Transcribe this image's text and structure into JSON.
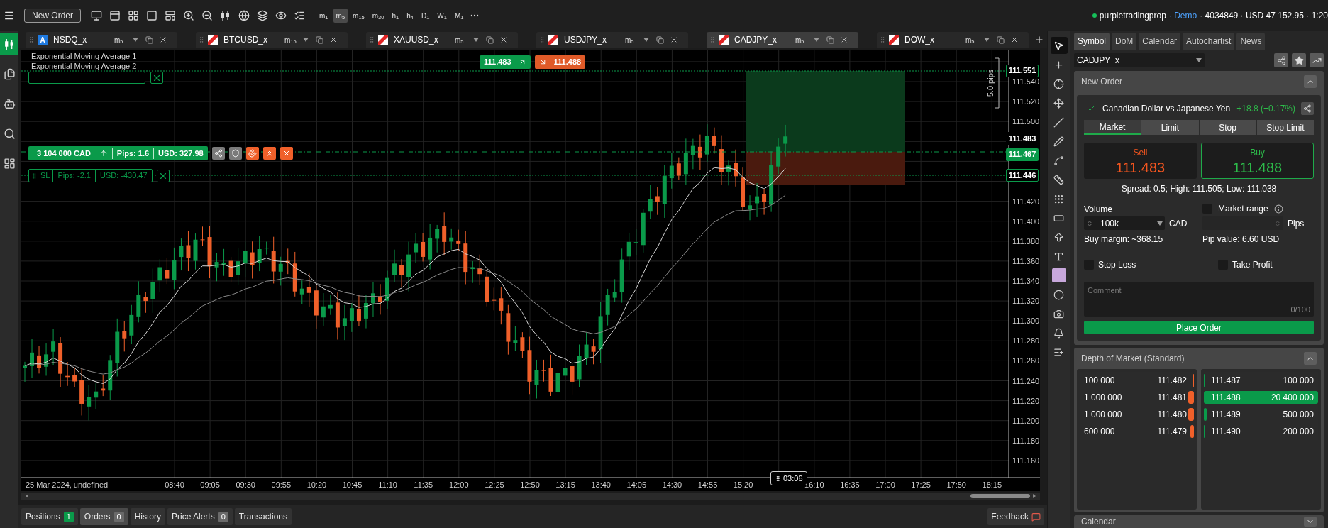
{
  "top_bar": {
    "new_order_button": "New Order",
    "timeframes": [
      {
        "label": "m$_{1}$",
        "selected": false
      },
      {
        "label": "m$_{5}$",
        "selected": true
      },
      {
        "label": "m$_{15}$",
        "selected": false
      },
      {
        "label": "m$_{30}$",
        "selected": false
      },
      {
        "label": "h$_{1}$",
        "selected": false
      },
      {
        "label": "h$_{4}$",
        "selected": false
      },
      {
        "label": "D$_{1}$",
        "selected": false
      },
      {
        "label": "W$_{1}$",
        "selected": false
      },
      {
        "label": "M$_{1}$",
        "selected": false
      }
    ],
    "account": {
      "name": "purpletradingprop",
      "mode": "· Demo",
      "details": "· 4034849 · USD 47 152.95 · 1:20"
    }
  },
  "left_sidebar": [
    {
      "selected": true
    },
    {
      "selected": false
    },
    {
      "selected": false
    },
    {
      "selected": false
    },
    {
      "selected": false
    }
  ],
  "chart_tabs": [
    {
      "kind": "letter",
      "badge": "A",
      "symbol": "NSDQ_x",
      "timeframe": "m$_{5}$",
      "selected": false
    },
    {
      "kind": "flag",
      "symbol": "BTCUSD_x",
      "timeframe": "m$_{15}$",
      "selected": false
    },
    {
      "kind": "flag",
      "symbol": "XAUUSD_x",
      "timeframe": "m$_{5}$",
      "selected": false
    },
    {
      "kind": "flag",
      "symbol": "USDJPY_x",
      "timeframe": "m$_{5}$",
      "selected": false
    },
    {
      "kind": "flag",
      "symbol": "CADJPY_x",
      "timeframe": "m$_{5}$",
      "selected": true
    },
    {
      "kind": "flag",
      "symbol": "DOW_x",
      "timeframe": "m$_{5}$",
      "selected": false
    }
  ],
  "chart": {
    "legend": [
      "Exponential Moving Average 1",
      "Exponential Moving Average 2"
    ],
    "quotes": [
      {
        "kind": "bid",
        "price": "111.483"
      },
      {
        "kind": "ask",
        "price": "111.488"
      }
    ],
    "position_line": {
      "volume": "3 104 000 CAD",
      "pips": "Pips: 1.6",
      "pnl": "USD: 327.98"
    },
    "stop_loss_line": {
      "label": "SL",
      "pips": "Pips: -2.1",
      "pnl": "USD: -430.47"
    },
    "price_ticks": [
      "111.540",
      "111.520",
      "111.500",
      "111.420",
      "111.400",
      "111.380",
      "111.360",
      "111.340",
      "111.320",
      "111.300",
      "111.280",
      "111.260",
      "111.240",
      "111.220",
      "111.200",
      "111.180",
      "111.160"
    ],
    "price_tags": [
      {
        "kind": "tp",
        "price": "111.551"
      },
      {
        "kind": "last",
        "price": "111.483"
      },
      {
        "kind": "position",
        "price": "111.467"
      },
      {
        "kind": "sl",
        "price": "111.446"
      }
    ],
    "range_label": "5.0 pips",
    "date_label": "25 Mar 2024, undefined",
    "time_ticks": [
      "08:40",
      "09:05",
      "09:30",
      "09:55",
      "10:20",
      "10:45",
      "11:10",
      "11:35",
      "12:00",
      "12:25",
      "12:50",
      "13:15",
      "13:40",
      "14:05",
      "14:30",
      "14:55",
      "15:20",
      "16:10",
      "16:35",
      "17:00",
      "17:25",
      "17:50",
      "18:15"
    ],
    "countdown": "03:06"
  },
  "bottom_tabs": [
    {
      "label": "Positions",
      "count": "1",
      "color": "#0a9a4a",
      "selected": false
    },
    {
      "label": "Orders",
      "count": "0",
      "color": "#6a6a6a",
      "selected": true
    },
    {
      "label": "History",
      "selected": false
    },
    {
      "label": "Price Alerts",
      "count": "0",
      "color": "#6a6a6a",
      "selected": false
    },
    {
      "label": "Transactions",
      "selected": false
    }
  ],
  "feedback": "Feedback",
  "drawing_tools": [
    {
      "selected": true
    },
    {
      "selected": false
    },
    {
      "selected": false
    },
    {
      "selected": false
    },
    {
      "selected": false
    },
    {
      "selected": false
    },
    {
      "selected": false
    },
    {
      "selected": false
    },
    {
      "selected": false
    },
    {
      "selected": false
    },
    {
      "selected": false
    },
    {
      "selected": false
    },
    {
      "selected": false
    },
    {
      "selected": false
    },
    {
      "selected": false
    },
    {
      "selected": false
    },
    {
      "selected": false
    }
  ],
  "side_tabs": [
    {
      "label": "Symbol",
      "selected": true
    },
    {
      "label": "DoM",
      "selected": false
    },
    {
      "label": "Calendar",
      "selected": false
    },
    {
      "label": "Autochartist",
      "selected": false
    },
    {
      "label": "News",
      "selected": false
    }
  ],
  "symbol_select": "CADJPY_x",
  "new_order": {
    "title": "New Order",
    "expanded": true,
    "instrument": "Canadian Dollar vs Japanese Yen",
    "change": "+18.8 (+0.17%)",
    "order_types": [
      {
        "label": "Market",
        "selected": true
      },
      {
        "label": "Limit",
        "selected": false
      },
      {
        "label": "Stop",
        "selected": false
      },
      {
        "label": "Stop Limit",
        "selected": false
      }
    ],
    "sell": {
      "label": "Sell",
      "price": "111.483",
      "selected": false
    },
    "buy": {
      "label": "Buy",
      "price": "111.488",
      "selected": true
    },
    "stats": "Spread: 0.5; High: 111.505; Low: 111.038",
    "volume_label": "Volume",
    "volume": "100k",
    "currency": "CAD",
    "market_range": {
      "label": "Market range",
      "checked": false
    },
    "pips_unit": "Pips",
    "buy_margin": "Buy margin: ~368.15",
    "pip_value": "Pip value: 6.60 USD",
    "stop_loss": {
      "label": "Stop Loss",
      "checked": false
    },
    "take_profit": {
      "label": "Take Profit",
      "checked": false
    },
    "comment": {
      "placeholder": "Comment",
      "counter": "0/100"
    },
    "submit": "Place Order"
  },
  "depth_of_market": {
    "title": "Depth of Market (Standard)",
    "expanded": true,
    "bids": [
      {
        "volume": "100 000",
        "price": "111.482",
        "level": 0.005
      },
      {
        "volume": "1 000 000",
        "price": "111.481",
        "level": 0.049
      },
      {
        "volume": "1 000 000",
        "price": "111.480",
        "level": 0.049
      },
      {
        "volume": "600 000",
        "price": "111.479",
        "level": 0.029
      }
    ],
    "asks": [
      {
        "price": "111.487",
        "volume": "100 000",
        "level": 0.005
      },
      {
        "price": "111.488",
        "volume": "20 400 000",
        "level": 1
      },
      {
        "price": "111.489",
        "volume": "500 000",
        "level": 0.025
      },
      {
        "price": "111.490",
        "volume": "200 000",
        "level": 0.01
      }
    ]
  },
  "calendar": {
    "title": "Calendar",
    "expanded": false
  }
}
